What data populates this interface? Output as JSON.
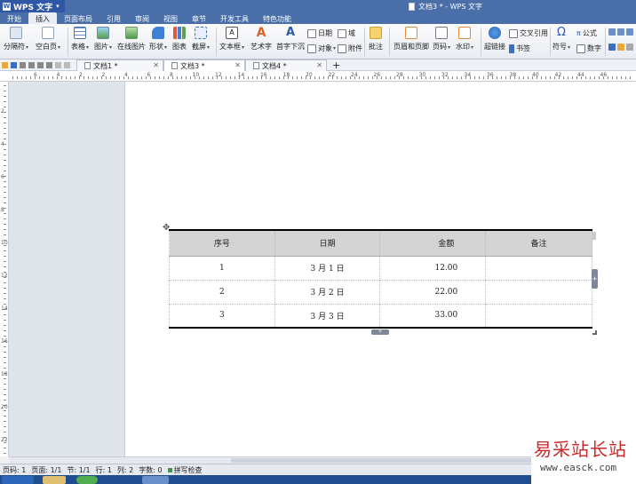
{
  "app": {
    "name": "WPS 文字",
    "window_title": "文档3 * - WPS 文字"
  },
  "menu_tabs": [
    "开始",
    "插入",
    "页面布局",
    "引用",
    "审阅",
    "视图",
    "章节",
    "开发工具",
    "特色功能"
  ],
  "active_menu_tab": "插入",
  "ribbon": {
    "page_break": "分隔符",
    "blank_page": "空白页",
    "table": "表格",
    "picture": "图片",
    "online_picture": "在线图片",
    "shapes": "形状",
    "chart": "图表",
    "screenshot": "截屏",
    "text_box": "文本框",
    "word_art": "艺术字",
    "drop_cap": "首字下沉",
    "date": "日期",
    "object": "对象",
    "field": "域",
    "attachment": "附件",
    "comment": "批注",
    "header_footer": "页眉和页脚",
    "page_number": "页码",
    "watermark": "水印",
    "hyperlink": "超链接",
    "cross_reference": "交叉引用",
    "bookmark": "书签",
    "symbol": "符号",
    "formula": "公式",
    "number": "数字"
  },
  "doc_tabs": [
    {
      "label": "文档1 *"
    },
    {
      "label": "文档3 *"
    },
    {
      "label": "文档4 *"
    }
  ],
  "new_tab_label": "+",
  "ruler_numbers_h": [
    "6",
    "4",
    "2",
    "2",
    "4",
    "6",
    "8",
    "10",
    "12",
    "14",
    "16",
    "18",
    "20",
    "22",
    "24",
    "26",
    "28",
    "30",
    "32",
    "34",
    "36",
    "38",
    "40",
    "42",
    "44",
    "46"
  ],
  "ruler_numbers_v": [
    "2",
    "4",
    "6",
    "8",
    "10",
    "12",
    "14",
    "16",
    "18",
    "20",
    "22"
  ],
  "table": {
    "headers": [
      "序号",
      "日期",
      "金额",
      "备注"
    ],
    "rows": [
      [
        "1",
        "3 月 1 日",
        "12.00",
        ""
      ],
      [
        "2",
        "3 月 2 日",
        "22.00",
        ""
      ],
      [
        "3",
        "3 月 3 日",
        "33.00",
        ""
      ]
    ]
  },
  "status": {
    "page": "页码: 1",
    "pages": "页面: 1/1",
    "section": "节: 1/1",
    "line": "行: 1",
    "column": "列: 2",
    "words": "字数: 0",
    "spell_check": "拼写检查"
  },
  "watermark": {
    "cn": "易采站长站",
    "url": "www.easck.com"
  },
  "colors": {
    "title_bar": "#4a6fa8",
    "app_button": "#2f57a5",
    "watermark_red": "#c62a2a"
  }
}
